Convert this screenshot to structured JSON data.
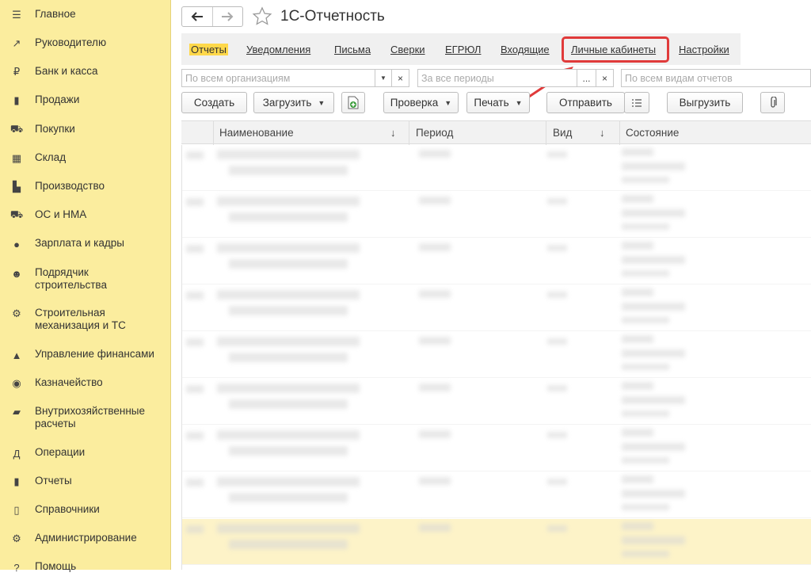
{
  "sidebar": {
    "items": [
      {
        "label": "Главное",
        "icon": "menu-icon"
      },
      {
        "label": "Руководителю",
        "icon": "trend-icon"
      },
      {
        "label": "Банк и касса",
        "icon": "ruble-icon"
      },
      {
        "label": "Продажи",
        "icon": "bag-icon"
      },
      {
        "label": "Покупки",
        "icon": "cart-icon"
      },
      {
        "label": "Склад",
        "icon": "warehouse-icon"
      },
      {
        "label": "Производство",
        "icon": "factory-icon"
      },
      {
        "label": "ОС и НМА",
        "icon": "truck-icon"
      },
      {
        "label": "Зарплата и кадры",
        "icon": "person-icon"
      },
      {
        "label": "Подрядчик\nстроительства",
        "icon": "worker-icon"
      },
      {
        "label": "Строительная\nмеханизация и ТС",
        "icon": "machinery-icon"
      },
      {
        "label": "Управление финансами",
        "icon": "finance-icon"
      },
      {
        "label": "Казначейство",
        "icon": "coins-icon"
      },
      {
        "label": "Внутрихозяйственные\nрасчеты",
        "icon": "book-icon"
      },
      {
        "label": "Операции",
        "icon": "dt-kt-icon"
      },
      {
        "label": "Отчеты",
        "icon": "bar-chart-icon"
      },
      {
        "label": "Справочники",
        "icon": "reference-book-icon"
      },
      {
        "label": "Администрирование",
        "icon": "gear-icon"
      },
      {
        "label": "Помощь",
        "icon": "help-icon"
      }
    ]
  },
  "header": {
    "title": "1С-Отчетность"
  },
  "tabs": [
    "Отчеты",
    "Уведомления",
    "Письма",
    "Сверки",
    "ЕГРЮЛ",
    "Входящие",
    "Личные кабинеты",
    "Настройки"
  ],
  "filters": {
    "organizations_placeholder": "По всем организациям",
    "periods_placeholder": "За все периоды",
    "report_types_placeholder": "По всем видам отчетов",
    "choose_label": "...",
    "clear_label": "×"
  },
  "toolbar": {
    "create": "Создать",
    "load": "Загрузить",
    "check": "Проверка",
    "print": "Печать",
    "send": "Отправить",
    "export": "Выгрузить"
  },
  "table": {
    "columns": [
      "Наименование",
      "Период",
      "Вид",
      "Состояние"
    ],
    "sort_indicator": "↓"
  },
  "colors": {
    "sidebar_bg": "#fbed9e",
    "active_tab": "#ffd84a",
    "highlight_red": "#e03a3a",
    "selected_row": "#fdf3c8"
  }
}
